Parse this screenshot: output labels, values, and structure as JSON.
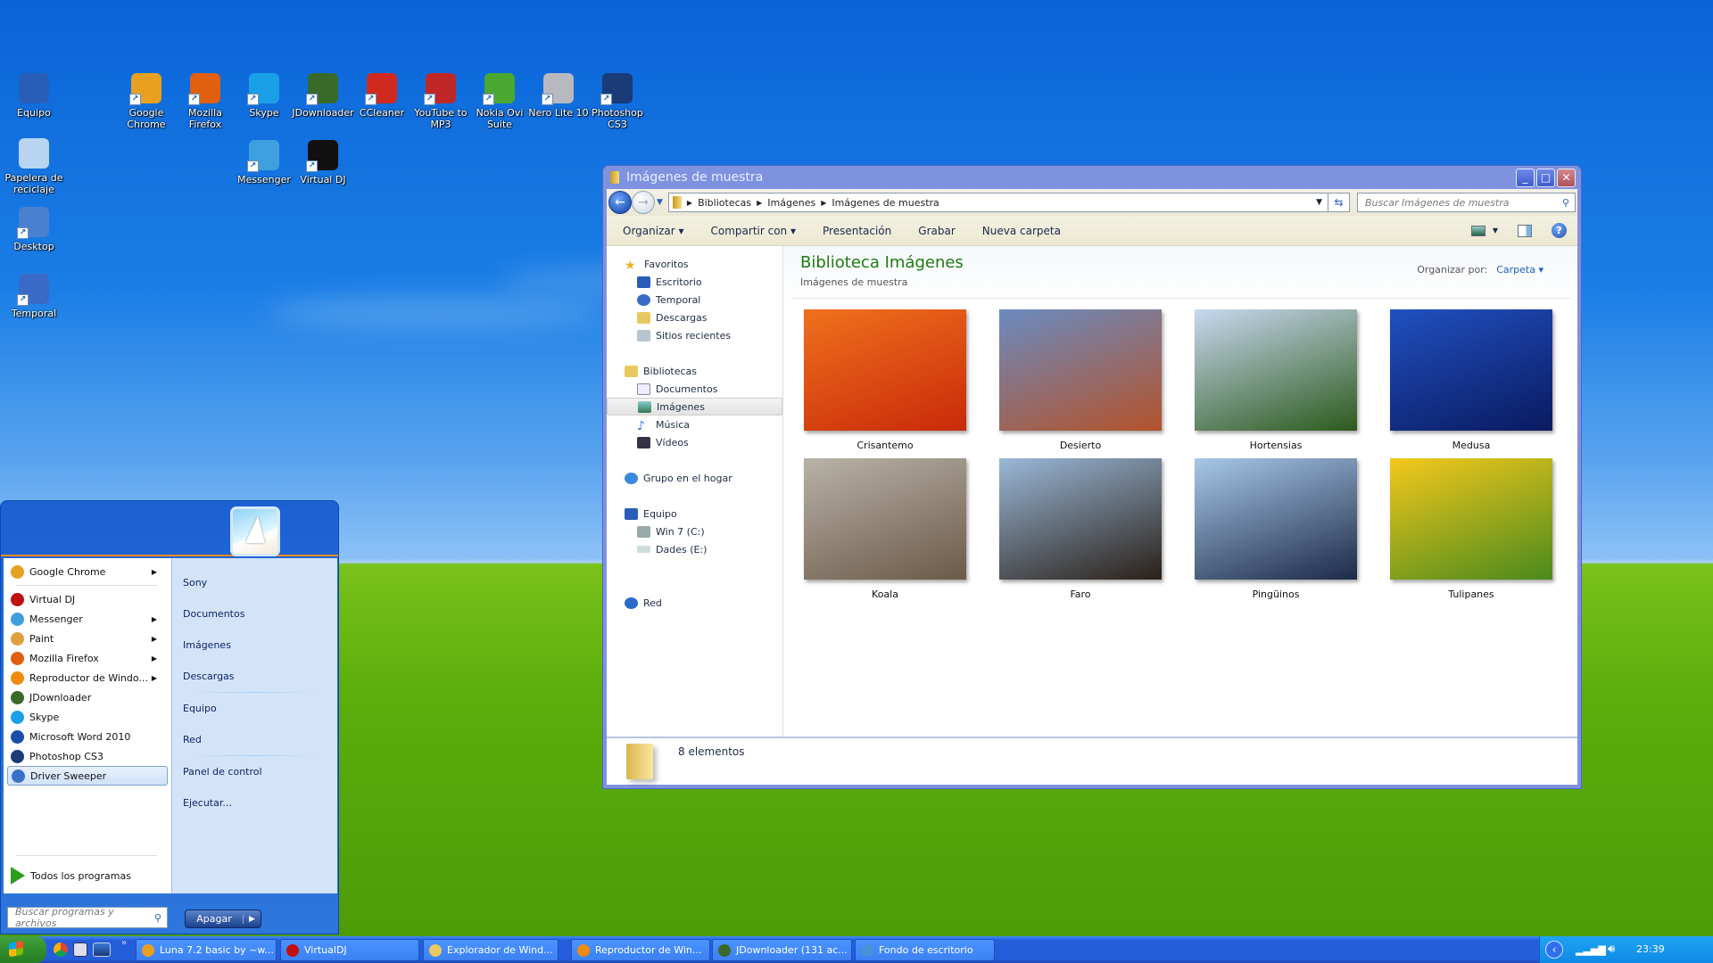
{
  "desktop": {
    "icons": [
      {
        "label": "Equipo",
        "icon": "computer-icon",
        "shortcut": false
      },
      {
        "label": "Papelera de reciclaje",
        "icon": "recycle-bin-icon",
        "shortcut": false
      },
      {
        "label": "Desktop",
        "icon": "desktop-shortcut-icon",
        "shortcut": true
      },
      {
        "label": "Temporal",
        "icon": "temporal-icon",
        "shortcut": true
      },
      {
        "label": "Google Chrome",
        "icon": "chrome-icon",
        "shortcut": true
      },
      {
        "label": "Mozilla Firefox",
        "icon": "firefox-icon",
        "shortcut": true
      },
      {
        "label": "Skype",
        "icon": "skype-icon",
        "shortcut": true
      },
      {
        "label": "JDownloader",
        "icon": "jdownloader-icon",
        "shortcut": true
      },
      {
        "label": "CCleaner",
        "icon": "ccleaner-icon",
        "shortcut": true
      },
      {
        "label": "YouTube to MP3",
        "icon": "youtube-mp3-icon",
        "shortcut": true
      },
      {
        "label": "Nokia Ovi Suite",
        "icon": "ovi-icon",
        "shortcut": true
      },
      {
        "label": "Nero Lite 10",
        "icon": "nero-icon",
        "shortcut": true
      },
      {
        "label": "Photoshop CS3",
        "icon": "photoshop-icon",
        "shortcut": true
      },
      {
        "label": "Messenger",
        "icon": "messenger-icon",
        "shortcut": true
      },
      {
        "label": "Virtual DJ",
        "icon": "virtualdj-icon",
        "shortcut": true
      }
    ]
  },
  "explorer": {
    "title": "Imágenes de muestra",
    "window_buttons": {
      "minimize": "_",
      "maximize": "□",
      "close": "✕"
    },
    "breadcrumb": [
      "Bibliotecas",
      "Imágenes",
      "Imágenes de muestra"
    ],
    "search_placeholder": "Buscar Imágenes de muestra",
    "commands": [
      "Organizar ▾",
      "Compartir con ▾",
      "Presentación",
      "Grabar",
      "Nueva carpeta"
    ],
    "nav": {
      "favorites_header": "Favoritos",
      "favorites": [
        "Escritorio",
        "Temporal",
        "Descargas",
        "Sitios recientes"
      ],
      "libraries_header": "Bibliotecas",
      "libraries": [
        "Documentos",
        "Imágenes",
        "Música",
        "Vídeos"
      ],
      "selected": "Imágenes",
      "homegroup": "Grupo en el hogar",
      "computer_header": "Equipo",
      "drives": [
        "Win 7 (C:)",
        "Dades (E:)"
      ],
      "network": "Red"
    },
    "library_title": "Biblioteca Imágenes",
    "library_subtitle": "Imágenes de muestra",
    "arrange_by_label": "Organizar por:",
    "arrange_by_value": "Carpeta ▾",
    "items": [
      {
        "name": "Crisantemo",
        "colors": [
          "#f0701c",
          "#c82a0a"
        ]
      },
      {
        "name": "Desierto",
        "colors": [
          "#6a8bc0",
          "#b4522a"
        ]
      },
      {
        "name": "Hortensias",
        "colors": [
          "#c8d8f0",
          "#2c5a1c"
        ]
      },
      {
        "name": "Medusa",
        "colors": [
          "#2050c0",
          "#0a1a60"
        ]
      },
      {
        "name": "Koala",
        "colors": [
          "#b8b2a8",
          "#6c5a48"
        ]
      },
      {
        "name": "Faro",
        "colors": [
          "#9ab8d8",
          "#2a2018"
        ]
      },
      {
        "name": "Pingüinos",
        "colors": [
          "#a8c8e8",
          "#1c2a48"
        ]
      },
      {
        "name": "Tulipanes",
        "colors": [
          "#f4c81c",
          "#4a8a1c"
        ]
      }
    ],
    "status": "8 elementos"
  },
  "startmenu": {
    "pinned": [
      {
        "label": "Google Chrome",
        "color": "#e8a020",
        "submenu": true
      }
    ],
    "recent": [
      {
        "label": "Virtual DJ",
        "color": "#c01010",
        "submenu": false
      },
      {
        "label": "Messenger",
        "color": "#3fa0e0",
        "submenu": true
      },
      {
        "label": "Paint",
        "color": "#e0a040",
        "submenu": true
      },
      {
        "label": "Mozilla Firefox",
        "color": "#e06010",
        "submenu": true
      },
      {
        "label": "Reproductor de Windo...",
        "color": "#f08a10",
        "submenu": true
      },
      {
        "label": "JDownloader",
        "color": "#3a6a2a",
        "submenu": false
      },
      {
        "label": "Skype",
        "color": "#1aa0e8",
        "submenu": false
      },
      {
        "label": "Microsoft Word 2010",
        "color": "#1a4ea8",
        "submenu": false
      },
      {
        "label": "Photoshop CS3",
        "color": "#1a3a78",
        "submenu": false
      },
      {
        "label": "Driver Sweeper",
        "color": "#3a70c8",
        "submenu": false
      }
    ],
    "highlighted": "Driver Sweeper",
    "all_programs": "Todos los programas",
    "right_group1": [
      "Sony",
      "Documentos",
      "Imágenes",
      "Descargas"
    ],
    "right_group2": [
      "Equipo",
      "Red"
    ],
    "right_group3": [
      "Panel de control",
      "Ejecutar..."
    ],
    "search_placeholder": "Buscar programas y archivos",
    "shutdown_label": "Apagar"
  },
  "taskbar": {
    "overflow": "»",
    "buttons": [
      {
        "label": "Luna 7.2 basic by ~w...",
        "color": "#e8a020"
      },
      {
        "label": "VirtualDJ",
        "color": "#c01010"
      },
      {
        "label": "Explorador de Wind...",
        "color": "#e8c860"
      },
      {
        "label": "Reproductor de Win...",
        "color": "#f08a10"
      },
      {
        "label": "JDownloader (131 ac...",
        "color": "#3a6a2a"
      },
      {
        "label": "Fondo de escritorio",
        "color": "#4a90d8"
      }
    ],
    "clock": "23:39"
  }
}
